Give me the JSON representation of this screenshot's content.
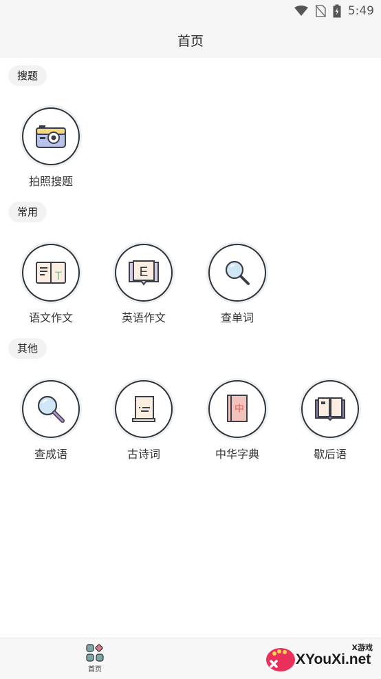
{
  "status": {
    "time": "5:49"
  },
  "header": {
    "title": "首页"
  },
  "sections": {
    "search": {
      "title": "搜题",
      "items": [
        {
          "label": "拍照搜题"
        }
      ]
    },
    "common": {
      "title": "常用",
      "items": [
        {
          "label": "语文作文"
        },
        {
          "label": "英语作文"
        },
        {
          "label": "查单词"
        }
      ]
    },
    "other": {
      "title": "其他",
      "items": [
        {
          "label": "查成语"
        },
        {
          "label": "古诗词"
        },
        {
          "label": "中华字典"
        },
        {
          "label": "歇后语"
        }
      ]
    }
  },
  "icons": {
    "photo_search": "camera-icon",
    "chinese_essay": "textbook-icon",
    "english_essay": "letter-e-book-icon",
    "word_lookup": "magnifier-icon",
    "idiom_lookup": "magnifier-icon",
    "poetry": "scroll-icon",
    "dictionary": "zhong-book-icon",
    "xiehouyu": "open-book-icon"
  },
  "icon_glyphs": {
    "english_letter": "E",
    "chinese_letter": "T",
    "dictionary_char": "中"
  },
  "bottom_nav": {
    "home_label": "首页"
  },
  "watermark": {
    "sub": "X游戏",
    "main": "XYouXi.net"
  },
  "colors": {
    "background": "#ffffff",
    "bar": "#f5f5f5",
    "pill": "#f2f2f2",
    "circle_border": "#2e3338",
    "camera_body": "#b9c3ea",
    "camera_top": "#f5d77e",
    "book_cream": "#fbeee0",
    "book_purple": "#8d7ba3",
    "magnifier_glass": "#cfe6f7",
    "magnifier_handle": "#b58ec9",
    "dictionary_cover": "#f2c3bd",
    "dictionary_char": "#e35d52",
    "green_letter": "#7dc492"
  }
}
